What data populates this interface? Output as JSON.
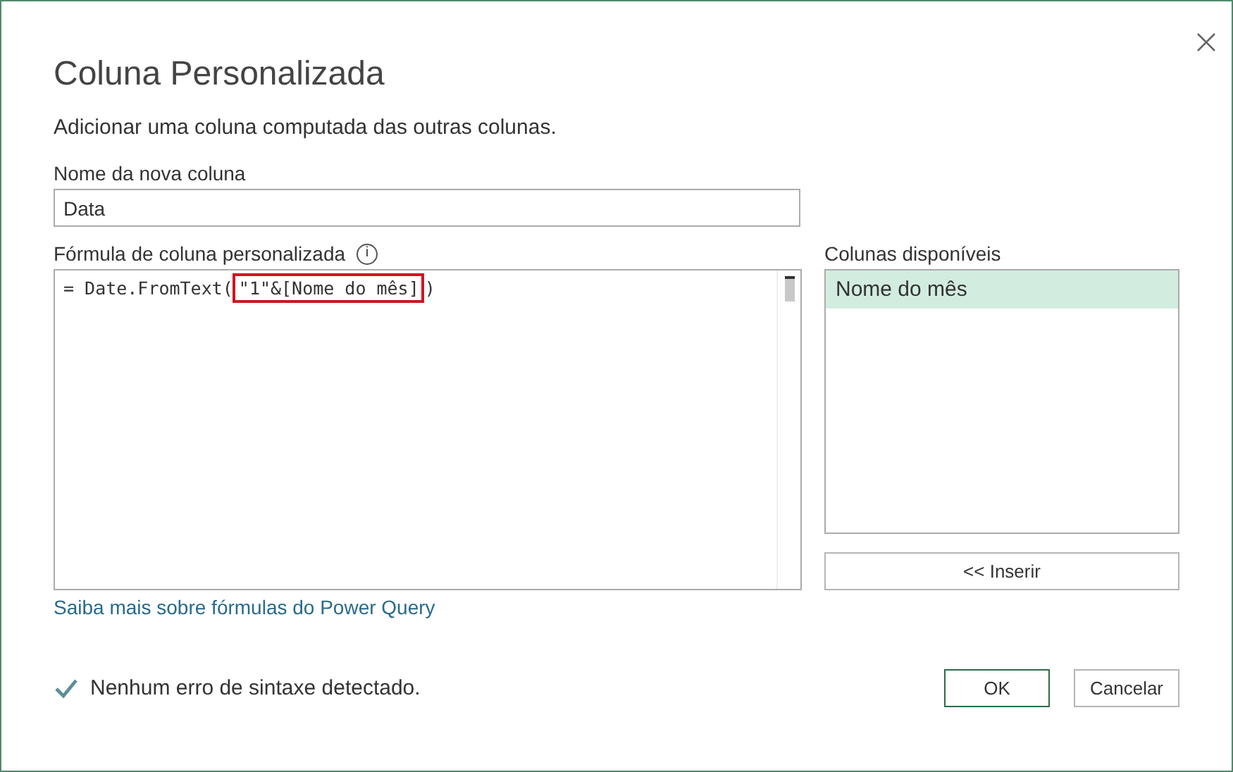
{
  "dialog": {
    "title": "Coluna Personalizada",
    "subtitle": "Adicionar uma coluna computada das outras colunas."
  },
  "name_field": {
    "label": "Nome da nova coluna",
    "value": "Data"
  },
  "formula": {
    "label": "Fórmula de coluna personalizada",
    "info_icon": "i",
    "before": "= Date.FromText(",
    "highlighted": "\"1\"&[Nome do mês]",
    "after": ")"
  },
  "available_columns": {
    "label": "Colunas disponíveis",
    "items": [
      {
        "name": "Nome do mês",
        "selected": true
      }
    ],
    "insert_button": "<< Inserir"
  },
  "help_link": "Saiba mais sobre fórmulas do Power Query",
  "status": {
    "ok": true,
    "message": "Nenhum erro de sintaxe detectado."
  },
  "buttons": [
    {
      "label": "OK",
      "default": true
    },
    {
      "label": "Cancelar",
      "default": false
    }
  ]
}
